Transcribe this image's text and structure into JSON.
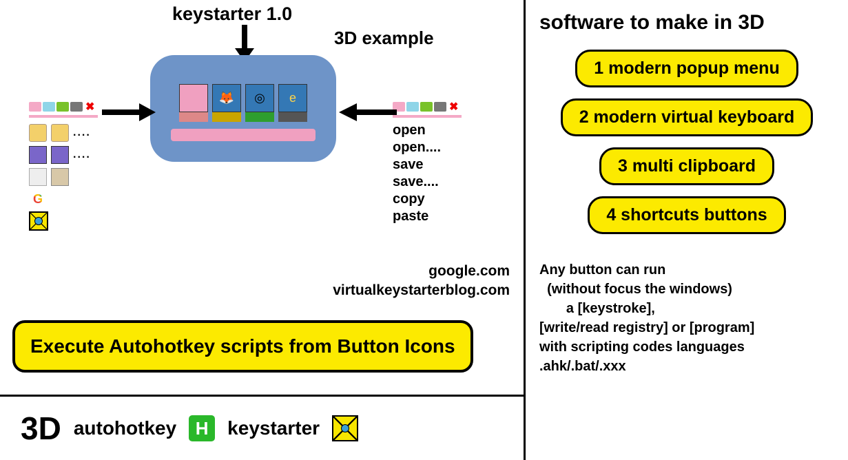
{
  "header": {
    "keystarter_label": "keystarter 1.0",
    "example_label": "3D example"
  },
  "palette_colors": [
    "pink",
    "cyan",
    "green",
    "gray"
  ],
  "left_icons": {
    "row1_dots": "....",
    "row2_dots": "....",
    "google_letter": "G"
  },
  "menu": {
    "items": [
      "open",
      "open....",
      "save",
      "save....",
      "copy",
      "paste"
    ]
  },
  "links": {
    "google": "google.com",
    "blog": "virtualkeystarterblog.com"
  },
  "big_button": "Execute Autohotkey scripts from Button Icons",
  "footer": {
    "threeD": "3D",
    "ahk": "autohotkey",
    "ahk_letter": "H",
    "keystarter": "keystarter"
  },
  "right": {
    "title": "software to make in 3D",
    "buttons": [
      "1 modern popup menu",
      "2 modern virtual keyboard",
      "3 multi clipboard",
      "4 shortcuts buttons"
    ],
    "desc": [
      "Any button can run",
      "  (without focus the windows)",
      "       a [keystroke],",
      "[write/read registry] or [program]",
      "with scripting codes languages",
      ".ahk/.bat/.xxx"
    ]
  }
}
